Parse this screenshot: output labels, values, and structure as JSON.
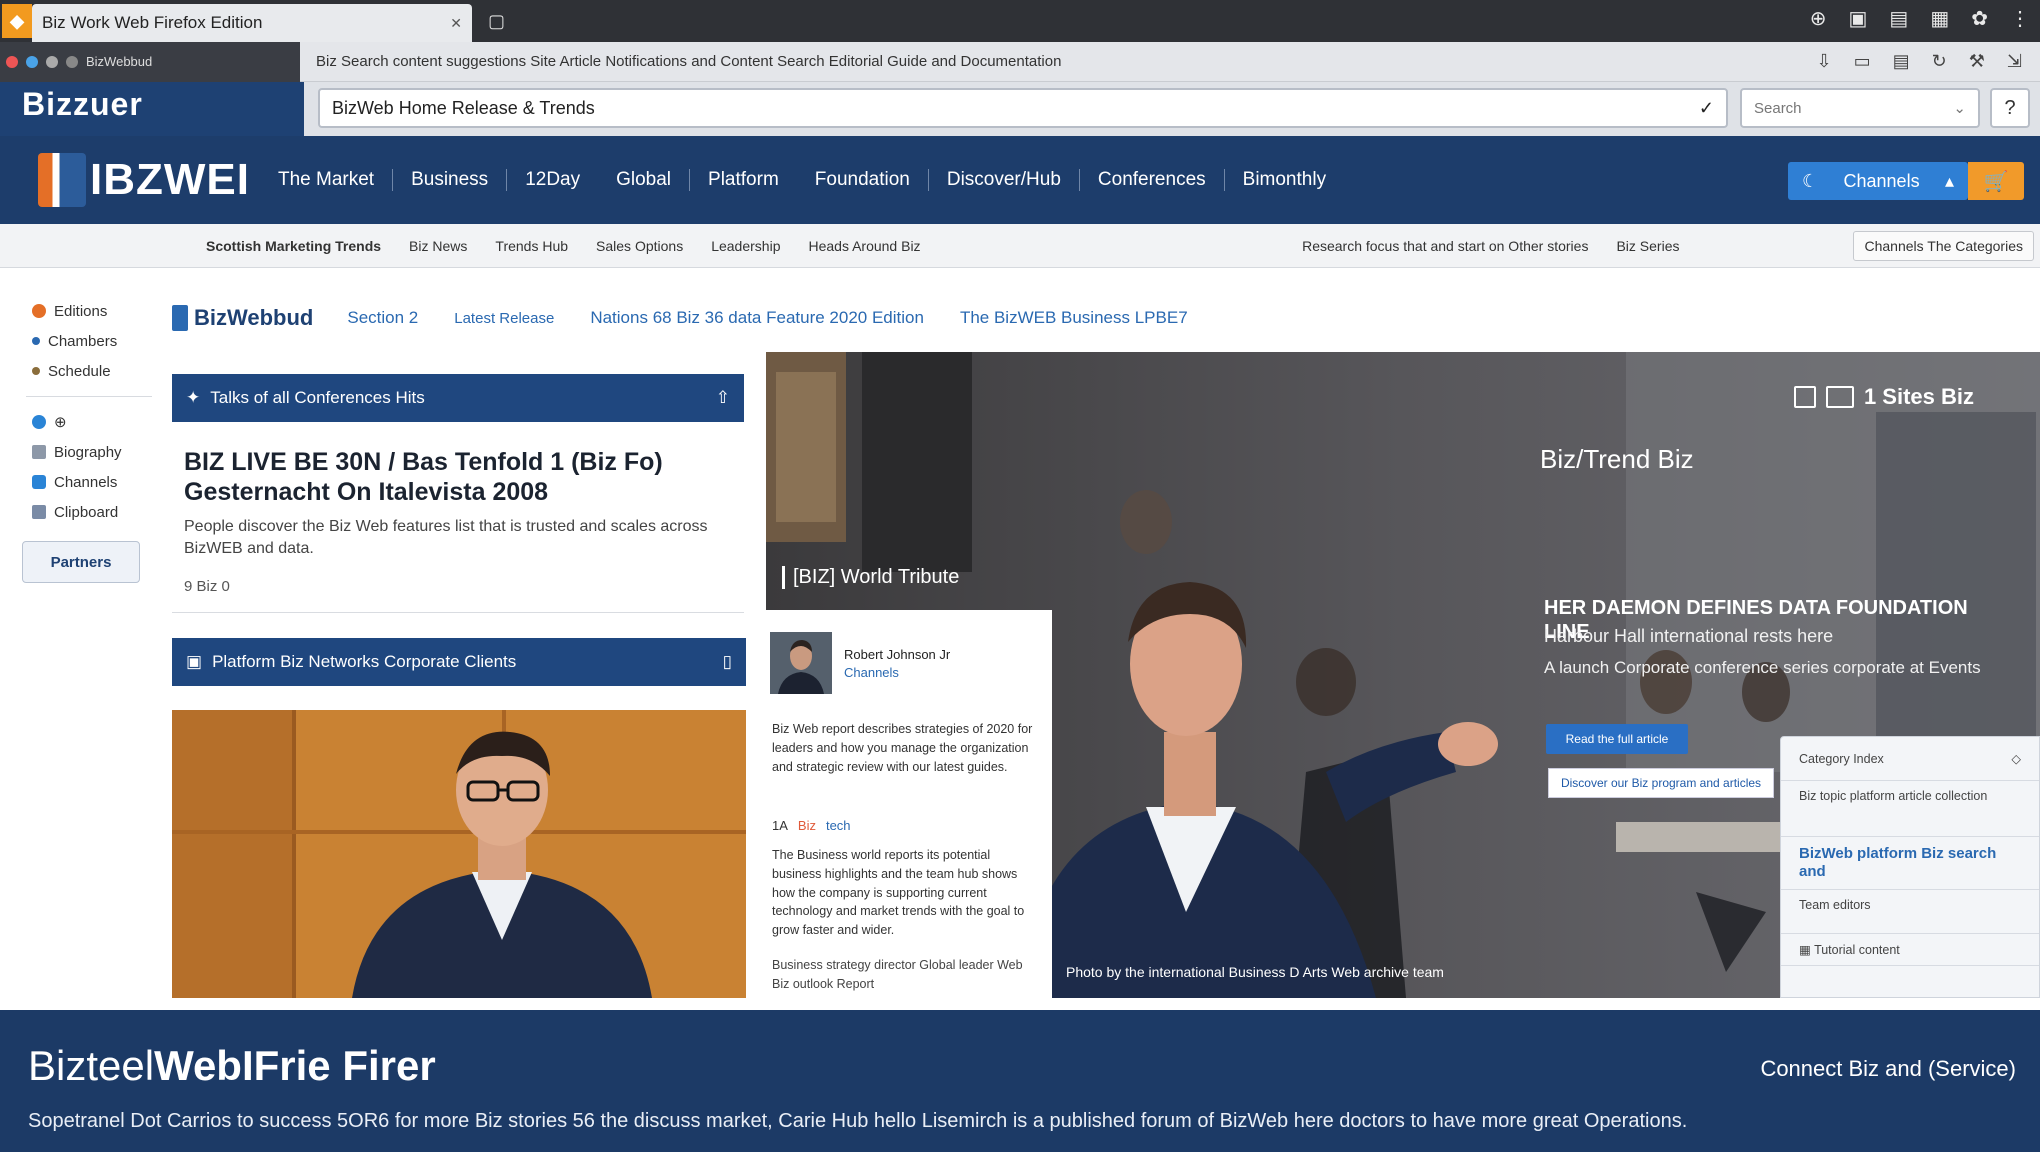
{
  "browser": {
    "tab_title": "Biz Work Web Firefox Edition",
    "tab_url_hint": "webfirefox",
    "toolbar_text": "Biz Search content suggestions Site Article Notifications and Content Search Editorial Guide and Documentation",
    "address": "BizWeb Home Release & Trends",
    "search_placeholder": "Search",
    "help_label": "?"
  },
  "site": {
    "app_brand": "Bizzuer",
    "logo_text": "IBZWEI",
    "nav": [
      "The Market",
      "Business",
      "12Day",
      "Global",
      "Platform",
      "Foundation",
      "Discover/Hub",
      "Conferences",
      "Bimonthly"
    ],
    "cta_label": "Channels",
    "subnav_left": [
      "Scottish Marketing Trends",
      "Biz News",
      "Trends Hub",
      "Sales Options",
      "Leadership",
      "Heads Around Biz"
    ],
    "subnav_right": "Research focus that and start on Other stories",
    "subnav_extra": "Biz Series",
    "subnav_box": "Channels  The  Categories"
  },
  "rail": {
    "items": [
      {
        "label": "Editions",
        "color": "#e46f27"
      },
      {
        "label": "Chambers",
        "color": "#2a69b1"
      },
      {
        "label": "Schedule",
        "color": "#8a6d3b"
      }
    ],
    "items2": [
      {
        "label": "",
        "color": "#2a84d6"
      },
      {
        "label": "Biography",
        "color": "#8d98a8"
      },
      {
        "label": "Channels",
        "color": "#2a84d6"
      },
      {
        "label": "Clipboard",
        "color": "#7a8ba6"
      }
    ],
    "button": "Partners"
  },
  "section_tabs": {
    "brand": "BizWebbud",
    "tabs": [
      "Section 2",
      "Latest Release",
      "Nations 68 Biz 36 data Feature 2020 Edition",
      "The BizWEB Business LPBE7"
    ]
  },
  "left_column": {
    "card1_title": "Talks of all Conferences Hits",
    "headline": "BIZ LIVE BE 30N / Bas Tenfold 1 (Biz Fo) Gesternacht On Italevista 2008",
    "summary": "People discover the Biz Web features list that is trusted and scales across BizWEB and data.",
    "meta": "9  Biz  0",
    "card2_title": "Platform Biz Networks Corporate Clients"
  },
  "hero": {
    "kicker": "[BIZ] World Tribute",
    "badge": "1 Sites Biz",
    "sub": "Biz/Trend Biz",
    "title": "HER DAEMON DEFINES DATA FOUNDATION LINE",
    "desc": "Harbour Hall international rests here",
    "desc2": "A launch Corporate conference series corporate at Events",
    "btn_primary": "Read the full article",
    "btn_secondary": "Discover our Biz program and articles",
    "caption": "Photo by the international Business D Arts Web archive team"
  },
  "insert": {
    "name": "Robert Johnson Jr",
    "role": "Channels",
    "p1": "Biz Web report describes strategies of 2020 for leaders and how you manage the organization and strategic review with our latest guides.",
    "tags": [
      "1A",
      "Biz",
      "tech"
    ],
    "p2": "The Business world reports its potential business highlights and the team hub shows how the company is supporting current technology and market trends with the goal to grow faster and wider.",
    "p3": "Business strategy director Global leader Web Biz outlook Report"
  },
  "sidepanel": {
    "head": "Category Index",
    "row1": "Biz topic platform article collection",
    "link": "BizWeb platform Biz search and",
    "row2": "Team editors",
    "row3": "Tutorial content"
  },
  "footer": {
    "title_light": "Bizteel",
    "title_bold": "WebIFrie Firer",
    "right": "Connect Biz and (Service)",
    "text": "Sopetranel Dot Carrios to success 5OR6 for more Biz stories 56 the discuss market, Carie Hub hello Lisemirch is a published forum of BizWeb here doctors to have more great Operations."
  },
  "colors": {
    "navy": "#1d3d6b",
    "accent_orange": "#f19a2a",
    "accent_blue": "#2f7fd4"
  }
}
